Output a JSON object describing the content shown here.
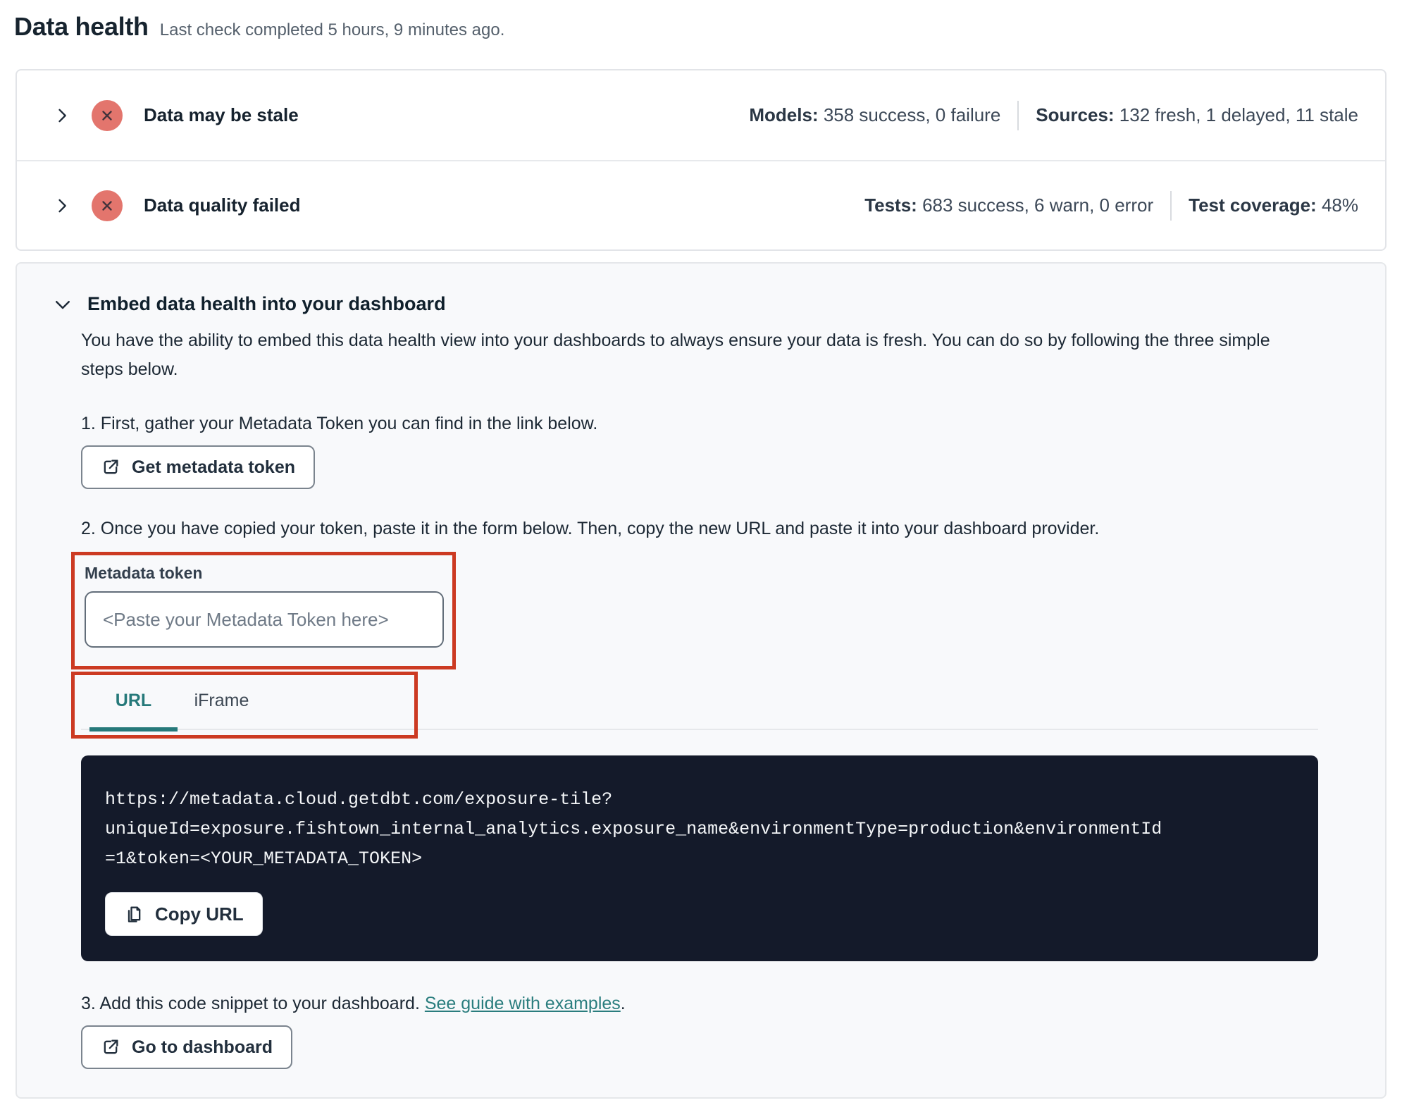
{
  "page": {
    "title": "Data health",
    "subtitle": "Last check completed 5 hours, 9 minutes ago."
  },
  "status_rows": [
    {
      "title": "Data may be stale",
      "status": "error",
      "stats": [
        {
          "label": "Models:",
          "value": "358 success, 0 failure"
        },
        {
          "label": "Sources:",
          "value": "132 fresh, 1 delayed, 11 stale"
        }
      ]
    },
    {
      "title": "Data quality failed",
      "status": "error",
      "stats": [
        {
          "label": "Tests:",
          "value": "683 success, 6 warn, 0 error"
        },
        {
          "label": "Test coverage:",
          "value": "48%"
        }
      ]
    }
  ],
  "embed": {
    "title": "Embed data health into your dashboard",
    "expanded": true,
    "description": "You have the ability to embed this data health view into your dashboards to always ensure your data is fresh. You can do so by following the three simple steps below.",
    "step1": "1. First, gather your Metadata Token you can find in the link below.",
    "get_token_button": "Get metadata token",
    "step2": "2. Once you have copied your token, paste it in the form below. Then, copy the new URL and paste it into your dashboard provider.",
    "token_field": {
      "label": "Metadata token",
      "value": "",
      "placeholder": "<Paste your Metadata Token here>"
    },
    "tabs": [
      {
        "label": "URL",
        "active": true
      },
      {
        "label": "iFrame",
        "active": false
      }
    ],
    "code_url": "https://metadata.cloud.getdbt.com/exposure-tile?uniqueId=exposure.fishtown_internal_analytics.exposure_name&environmentType=production&environmentId=1&token=<YOUR_METADATA_TOKEN>",
    "code_url_lines": [
      "https://metadata.cloud.getdbt.com/exposure-tile?",
      "uniqueId=exposure.fishtown_internal_analytics.exposure_name&environmentType=production&environmentId",
      "=1&token=<YOUR_METADATA_TOKEN>"
    ],
    "copy_button": "Copy URL",
    "step3_prefix": "3. Add this code snippet to your dashboard. ",
    "step3_link": "See guide with examples",
    "step3_suffix": ".",
    "dashboard_button": "Go to dashboard"
  },
  "colors": {
    "accent_teal": "#26797a",
    "annotation_red": "#cc3a22",
    "error_badge_red": "#e3756d",
    "code_background": "#141a2a"
  }
}
